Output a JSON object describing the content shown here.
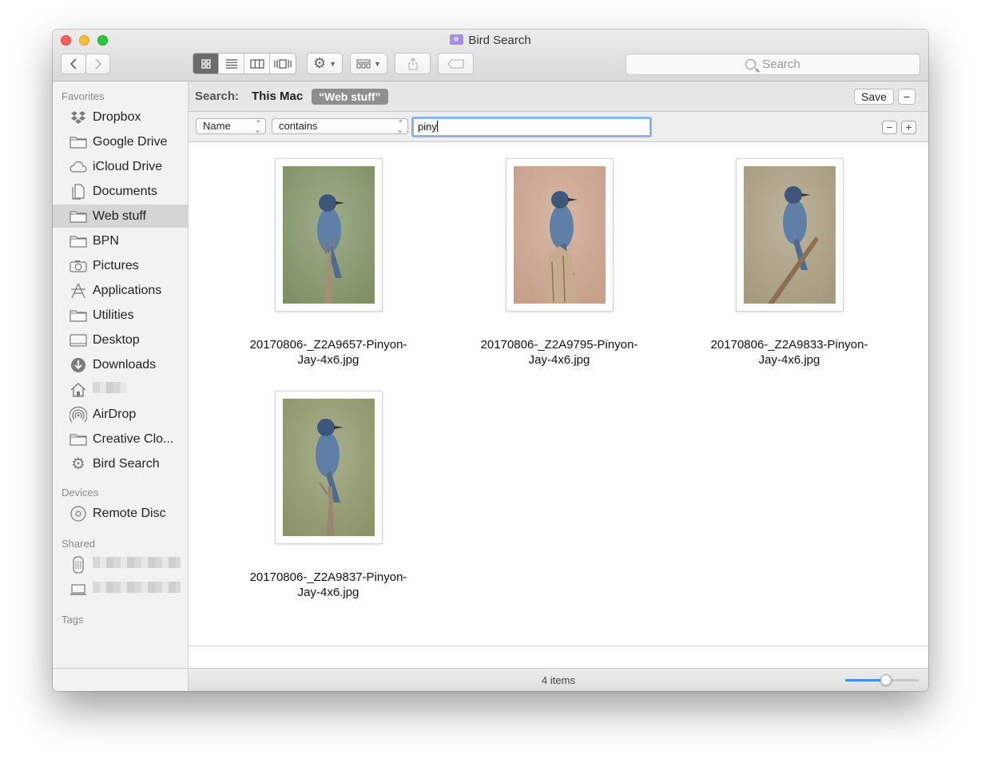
{
  "window": {
    "title": "Bird Search"
  },
  "toolbar": {
    "search_placeholder": "Search"
  },
  "sidebar": {
    "favorites_heading": "Favorites",
    "favorites": [
      {
        "label": "Dropbox",
        "icon": "dropbox-icon"
      },
      {
        "label": "Google Drive",
        "icon": "folder-icon"
      },
      {
        "label": "iCloud Drive",
        "icon": "cloud-icon"
      },
      {
        "label": "Documents",
        "icon": "documents-icon"
      },
      {
        "label": "Web stuff",
        "icon": "folder-icon",
        "selected": true
      },
      {
        "label": "BPN",
        "icon": "folder-icon"
      },
      {
        "label": "Pictures",
        "icon": "camera-icon"
      },
      {
        "label": "Applications",
        "icon": "applications-icon"
      },
      {
        "label": "Utilities",
        "icon": "folder-icon"
      },
      {
        "label": "Desktop",
        "icon": "desktop-icon"
      },
      {
        "label": "Downloads",
        "icon": "download-icon"
      },
      {
        "label": "",
        "icon": "home-icon",
        "redacted": true
      },
      {
        "label": "AirDrop",
        "icon": "airdrop-icon"
      },
      {
        "label": "Creative Clo...",
        "icon": "folder-icon"
      },
      {
        "label": "Bird Search",
        "icon": "gear-icon"
      }
    ],
    "devices_heading": "Devices",
    "devices": [
      {
        "label": "Remote Disc",
        "icon": "disc-icon"
      }
    ],
    "shared_heading": "Shared",
    "shared": [
      {
        "label": "",
        "icon": "server-icon",
        "redacted": true
      },
      {
        "label": "",
        "icon": "laptop-icon",
        "redacted": true
      }
    ],
    "tags_heading": "Tags"
  },
  "scope": {
    "label": "Search:",
    "this_mac": "This Mac",
    "selected_scope": "“Web stuff”",
    "save_label": "Save",
    "remove_label": "−"
  },
  "criteria": {
    "attribute": "Name",
    "operator": "contains",
    "value": "piny",
    "remove_label": "−",
    "add_label": "+"
  },
  "files": [
    {
      "name": "20170806-_Z2A9657-Pinyon-Jay-4x6.jpg",
      "name_line1": "20170806-_Z2A9657-Pinyon-",
      "name_line2": "Jay-4x6.jpg",
      "bg": "#7f9164"
    },
    {
      "name": "20170806-_Z2A9795-Pinyon-Jay-4x6.jpg",
      "name_line1": "20170806-_Z2A9795-Pinyon-",
      "name_line2": "Jay-4x6.jpg",
      "bg": "#c79f88"
    },
    {
      "name": "20170806-_Z2A9833-Pinyon-Jay-4x6.jpg",
      "name_line1": "20170806-_Z2A9833-Pinyon-",
      "name_line2": "Jay-4x6.jpg",
      "bg": "#a59a7c"
    },
    {
      "name": "20170806-_Z2A9837-Pinyon-Jay-4x6.jpg",
      "name_line1": "20170806-_Z2A9837-Pinyon-",
      "name_line2": "Jay-4x6.jpg",
      "bg": "#8c9467"
    }
  ],
  "status": {
    "item_count": "4 items",
    "icon_size_level": 0.55
  },
  "colors": {
    "accent": "#3d8ef4",
    "bird_blue": "#5f7fa6"
  }
}
